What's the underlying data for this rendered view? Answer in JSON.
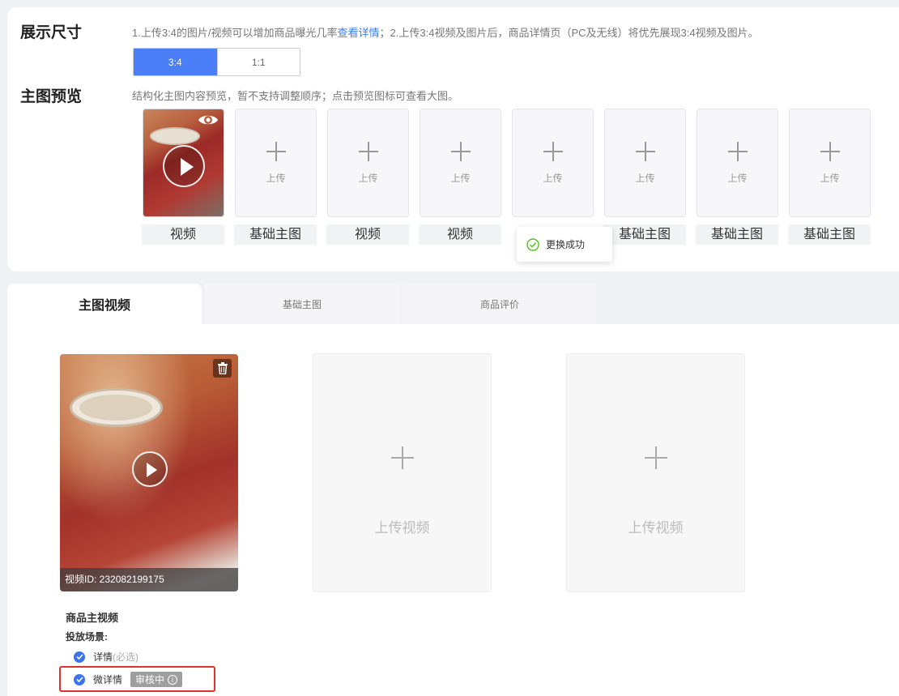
{
  "display_size": {
    "title": "展示尺寸",
    "hint_part1": "1.上传3:4的图片/视频可以增加商品曝光几率",
    "hint_link": "查看详情",
    "hint_part2": "；2.上传3:4视频及图片后，商品详情页（PC及无线）将优先展现3:4视频及图片。",
    "ratios": [
      {
        "label": "3:4",
        "active": true
      },
      {
        "label": "1:1",
        "active": false
      }
    ]
  },
  "main_preview": {
    "title": "主图预览",
    "hint": "结构化主图内容预览，暂不支持调整顺序；点击预览图标可查看大图。",
    "upload_label": "上传",
    "items": [
      {
        "caption": "视频",
        "filled": true
      },
      {
        "caption": "基础主图",
        "filled": false
      },
      {
        "caption": "视频",
        "filled": false
      },
      {
        "caption": "视频",
        "filled": false
      },
      {
        "caption": "",
        "filled": false
      },
      {
        "caption": "基础主图",
        "filled": false
      },
      {
        "caption": "基础主图",
        "filled": false
      },
      {
        "caption": "基础主图",
        "filled": false
      }
    ]
  },
  "toast": {
    "text": "更换成功",
    "icon": "check-circle-icon",
    "color": "#52c41a"
  },
  "tabs": [
    {
      "label": "主图视频",
      "active": true
    },
    {
      "label": "基础主图",
      "active": false
    },
    {
      "label": "商品评价",
      "active": false
    }
  ],
  "video_section": {
    "video_id": "视频ID: 232082199175",
    "upload_slot_label": "上传视频",
    "title": "商品主视频",
    "scene_label": "投放场景:",
    "scenes": [
      {
        "label": "详情",
        "suffix": "(必选)",
        "checked": true
      },
      {
        "label": "微详情",
        "suffix": "",
        "checked": true,
        "badge": "审核中"
      }
    ]
  },
  "colors": {
    "accent": "#4a7ff7",
    "highlight": "#e0322d",
    "badge_bg": "#9e9e9e"
  }
}
